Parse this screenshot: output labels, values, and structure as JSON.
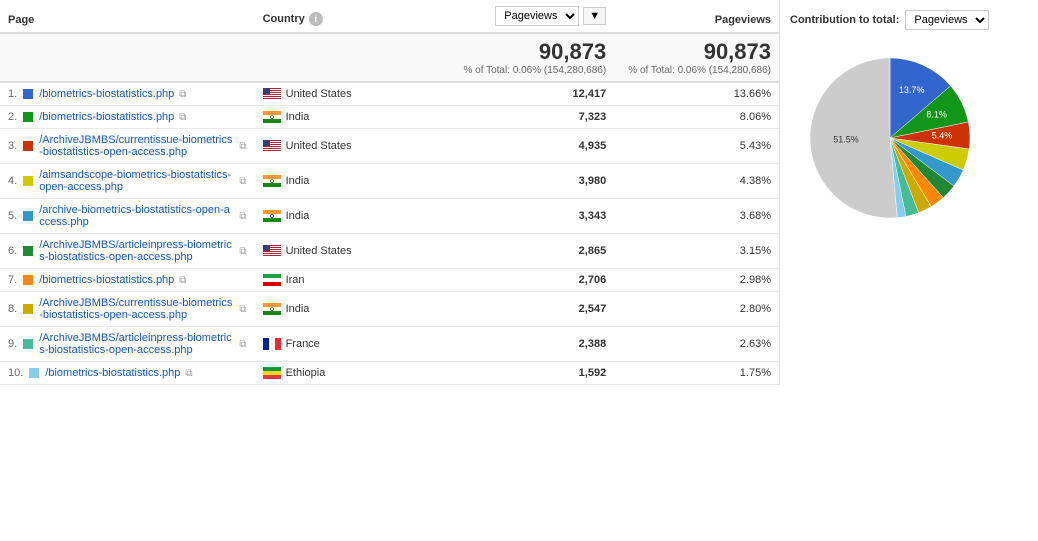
{
  "header": {
    "page_col": "Page",
    "country_col": "Country",
    "pageviews_label": "Pageviews",
    "contribution_label": "Contribution to total:",
    "contribution_metric": "Pageviews"
  },
  "totals": {
    "pv1": "90,873",
    "pv1_sub": "% of Total: 0.06% (154,280,686)",
    "pv2": "90,873",
    "pv2_sub": "% of Total: 0.06% (154,280,686)"
  },
  "rows": [
    {
      "num": "1.",
      "color": "#3366CC",
      "page": "/biometrics-biostatistics.php",
      "country_flag": "us",
      "country": "United States",
      "pv1": "12,417",
      "pv2": "13.66%"
    },
    {
      "num": "2.",
      "color": "#109618",
      "page": "/biometrics-biostatistics.php",
      "country_flag": "in",
      "country": "India",
      "pv1": "7,323",
      "pv2": "8.06%"
    },
    {
      "num": "3.",
      "color": "#CC3300",
      "page": "/ArchiveJBMBS/currentissue-biometrics-biostatistics-open-access.php",
      "country_flag": "us",
      "country": "United States",
      "pv1": "4,935",
      "pv2": "5.43%"
    },
    {
      "num": "4.",
      "color": "#CCCC00",
      "page": "/aimsandscope-biometrics-biostatistics-open-access.php",
      "country_flag": "in",
      "country": "India",
      "pv1": "3,980",
      "pv2": "4.38%"
    },
    {
      "num": "5.",
      "color": "#3399CC",
      "page": "/archive-biometrics-biostatistics-open-access.php",
      "country_flag": "in",
      "country": "India",
      "pv1": "3,343",
      "pv2": "3.68%"
    },
    {
      "num": "6.",
      "color": "#228833",
      "page": "/ArchiveJBMBS/articleinpress-biometrics-biostatistics-open-access.php",
      "country_flag": "us",
      "country": "United States",
      "pv1": "2,865",
      "pv2": "3.15%"
    },
    {
      "num": "7.",
      "color": "#FF8800",
      "page": "/biometrics-biostatistics.php",
      "country_flag": "ir",
      "country": "Iran",
      "pv1": "2,706",
      "pv2": "2.98%"
    },
    {
      "num": "8.",
      "color": "#CCAA00",
      "page": "/ArchiveJBMBS/currentissue-biometrics-biostatistics-open-access.php",
      "country_flag": "in",
      "country": "India",
      "pv1": "2,547",
      "pv2": "2.80%"
    },
    {
      "num": "9.",
      "color": "#44BB99",
      "page": "/ArchiveJBMBS/articleinpress-biometrics-biostatistics-open-access.php",
      "country_flag": "fr",
      "country": "France",
      "pv1": "2,388",
      "pv2": "2.63%"
    },
    {
      "num": "10.",
      "color": "#88CCEE",
      "page": "/biometrics-biostatistics.php",
      "country_flag": "et",
      "country": "Ethiopia",
      "pv1": "1,592",
      "pv2": "1.75%"
    }
  ],
  "pie": {
    "slices": [
      {
        "label": "13.7%",
        "color": "#3366CC",
        "percent": 13.7
      },
      {
        "label": "8.1%",
        "color": "#109618",
        "percent": 8.1
      },
      {
        "label": "5.4%",
        "color": "#CC3300",
        "percent": 5.4
      },
      {
        "label": "",
        "color": "#CCCC00",
        "percent": 4.38
      },
      {
        "label": "",
        "color": "#3399CC",
        "percent": 3.68
      },
      {
        "label": "",
        "color": "#228833",
        "percent": 3.15
      },
      {
        "label": "",
        "color": "#FF8800",
        "percent": 2.98
      },
      {
        "label": "",
        "color": "#CCAA00",
        "percent": 2.8
      },
      {
        "label": "",
        "color": "#44BB99",
        "percent": 2.63
      },
      {
        "label": "",
        "color": "#88CCEE",
        "percent": 1.75
      },
      {
        "label": "51.5%",
        "color": "#CCCCCC",
        "percent": 51.45
      }
    ]
  }
}
